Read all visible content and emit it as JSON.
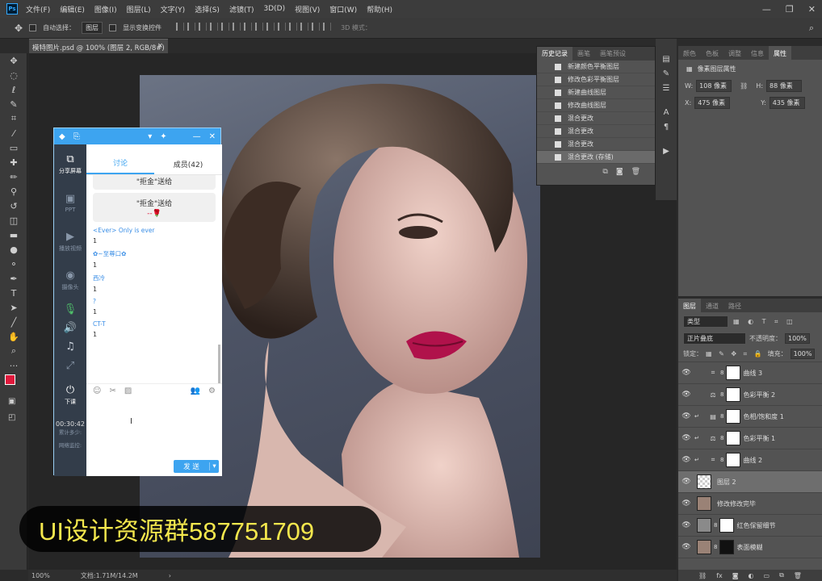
{
  "menubar": {
    "logo": "Ps",
    "items": [
      "文件(F)",
      "编辑(E)",
      "图像(I)",
      "图层(L)",
      "文字(Y)",
      "选择(S)",
      "滤镜(T)",
      "3D(D)",
      "视图(V)",
      "窗口(W)",
      "帮助(H)"
    ]
  },
  "options": {
    "auto_select_label": "自动选择：",
    "auto_select_value": "图层",
    "show_transform_label": "显示变换控件",
    "mode_3d": "3D 模式："
  },
  "document": {
    "tab_title": "模特图片.psd @ 100% (图层 2, RGB/8#)",
    "zoom": "100%",
    "doc_info": "文档:1.71M/14.2M"
  },
  "history": {
    "tabs": [
      "历史记录",
      "画笔",
      "画笔预设"
    ],
    "items": [
      "新建颜色平衡图层",
      "修改色彩平衡图层",
      "新建曲线图层",
      "修改曲线图层",
      "混合更改",
      "混合更改",
      "混合更改",
      "混合更改 (存储)"
    ]
  },
  "properties": {
    "tabs": [
      "颜色",
      "色板",
      "调整",
      "信息",
      "属性"
    ],
    "title": "像素图层属性",
    "w": "108 像素",
    "h": "88 像素",
    "x": "475 像素",
    "y": "435 像素",
    "w_label": "W:",
    "h_label": "H:",
    "x_label": "X:",
    "y_label": "Y:"
  },
  "layers": {
    "tabs": [
      "图层",
      "通道",
      "路径"
    ],
    "kind": "类型",
    "blend": "正片叠底",
    "opacity_label": "不透明度：",
    "opacity": "100%",
    "lock_label": "锁定：",
    "fill_label": "填充：",
    "fill": "100%",
    "items": [
      "曲线 3",
      "色彩平衡 2",
      "色相/饱和度 1",
      "色彩平衡 1",
      "曲线 2",
      "图层 2",
      "修改修改完毕",
      "红色保留细节",
      "表面模糊"
    ]
  },
  "chat": {
    "tabs": [
      "讨论",
      "成员(42)"
    ],
    "side_items": [
      "分享屏幕",
      "PPT",
      "播放视频",
      "摄像头",
      "下课"
    ],
    "timer": "00:30:42",
    "timer_sub": "累计多少:",
    "net_label": "网络监控:",
    "card_partial": "\"拒金\"送给",
    "card_text": "\"拒金\"送给",
    "messages": [
      {
        "name": "<Ever> Only is ever",
        "value": "1"
      },
      {
        "name": "✿~至尊口✿",
        "value": "1"
      },
      {
        "name": "西冷",
        "value": "1"
      },
      {
        "name": "?",
        "value": "1"
      },
      {
        "name": "CT-T",
        "value": "1"
      }
    ],
    "send_label": "发 送"
  },
  "watermark": {
    "text": "UI设计资源群587751709"
  },
  "colors": {
    "foreground": "#e0193c",
    "background": "#ffffff",
    "accent": "#3da4f0"
  }
}
